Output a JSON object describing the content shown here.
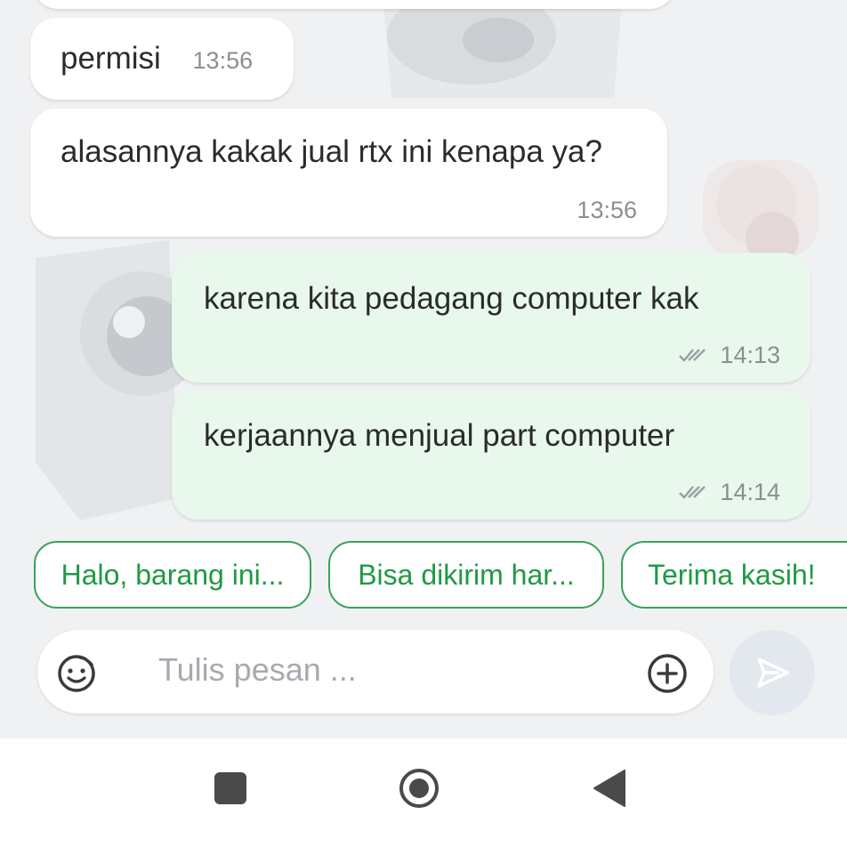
{
  "messages": [
    {
      "direction": "in",
      "text": "permisi",
      "time": "13:56"
    },
    {
      "direction": "in",
      "text": "alasannya kakak jual rtx ini kenapa ya?",
      "time": "13:56"
    },
    {
      "direction": "out",
      "text": "karena kita pedagang computer kak",
      "time": "14:13",
      "status": "read"
    },
    {
      "direction": "out",
      "text": "kerjaannya menjual part computer",
      "time": "14:14",
      "status": "read"
    }
  ],
  "quick_replies": [
    "Halo, barang ini...",
    "Bisa dikirim har...",
    "Terima kasih!"
  ],
  "composer": {
    "placeholder": "Tulis pesan ...",
    "emoji_icon": "smiley-icon",
    "attach_icon": "plus-circle-icon",
    "send_icon": "send-icon"
  },
  "navigation": {
    "recents_icon": "square-icon",
    "home_icon": "circle-home-icon",
    "back_icon": "triangle-back-icon"
  },
  "colors": {
    "chat_background": "#f0f1f3",
    "incoming_bubble": "#ffffff",
    "outgoing_bubble": "#e8f8ec",
    "accent_green": "#1f9a44",
    "timestamp": "#8a8f95",
    "placeholder": "#a6abb1"
  }
}
